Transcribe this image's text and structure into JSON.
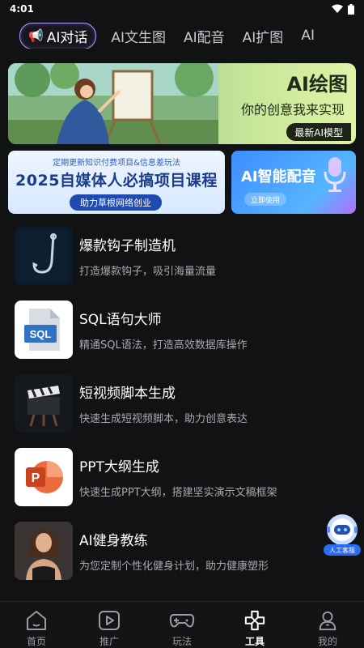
{
  "status": {
    "time": "4:01"
  },
  "tabs": [
    {
      "label": "AI对话",
      "active": true
    },
    {
      "label": "AI文生图"
    },
    {
      "label": "AI配音"
    },
    {
      "label": "AI扩图"
    },
    {
      "label": "AI"
    }
  ],
  "banner": {
    "title": "AI绘图",
    "subtitle": "你的创意我来实现",
    "badge": "最新AI模型"
  },
  "promo": {
    "top": "定期更新知识付费项目&信息差玩法",
    "main": "2025自媒体人必搞项目课程",
    "pill": "助力草根网络创业"
  },
  "voice": {
    "title": "AI智能配音",
    "button": "立即使用"
  },
  "tools": [
    {
      "title": "爆款钩子制造机",
      "desc": "打造爆款钩子，吸引海量流量",
      "icon": "hook-icon"
    },
    {
      "title": "SQL语句大师",
      "desc": "精通SQL语法，打造高效数据库操作",
      "icon": "sql-file-icon",
      "icon_text": "SQL"
    },
    {
      "title": "短视频脚本生成",
      "desc": "快速生成短视频脚本，助力创意表达",
      "icon": "clapperboard-icon"
    },
    {
      "title": "PPT大纲生成",
      "desc": "快速生成PPT大纲，搭建坚实演示文稿框架",
      "icon": "powerpoint-icon",
      "icon_text": "P"
    },
    {
      "title": "AI健身教练",
      "desc": "为您定制个性化健身计划，助力健康塑形",
      "icon": "fitness-coach-avatar"
    }
  ],
  "service": {
    "label": "人工客服"
  },
  "nav": [
    {
      "label": "首页",
      "icon": "home-icon"
    },
    {
      "label": "推广",
      "icon": "play-icon"
    },
    {
      "label": "玩法",
      "icon": "gamepad-icon"
    },
    {
      "label": "工具",
      "icon": "tools-icon",
      "active": true
    },
    {
      "label": "我的",
      "icon": "user-icon"
    }
  ],
  "colors": {
    "accent": "#b89cff",
    "background": "#111214",
    "service": "#2a6cf0"
  }
}
